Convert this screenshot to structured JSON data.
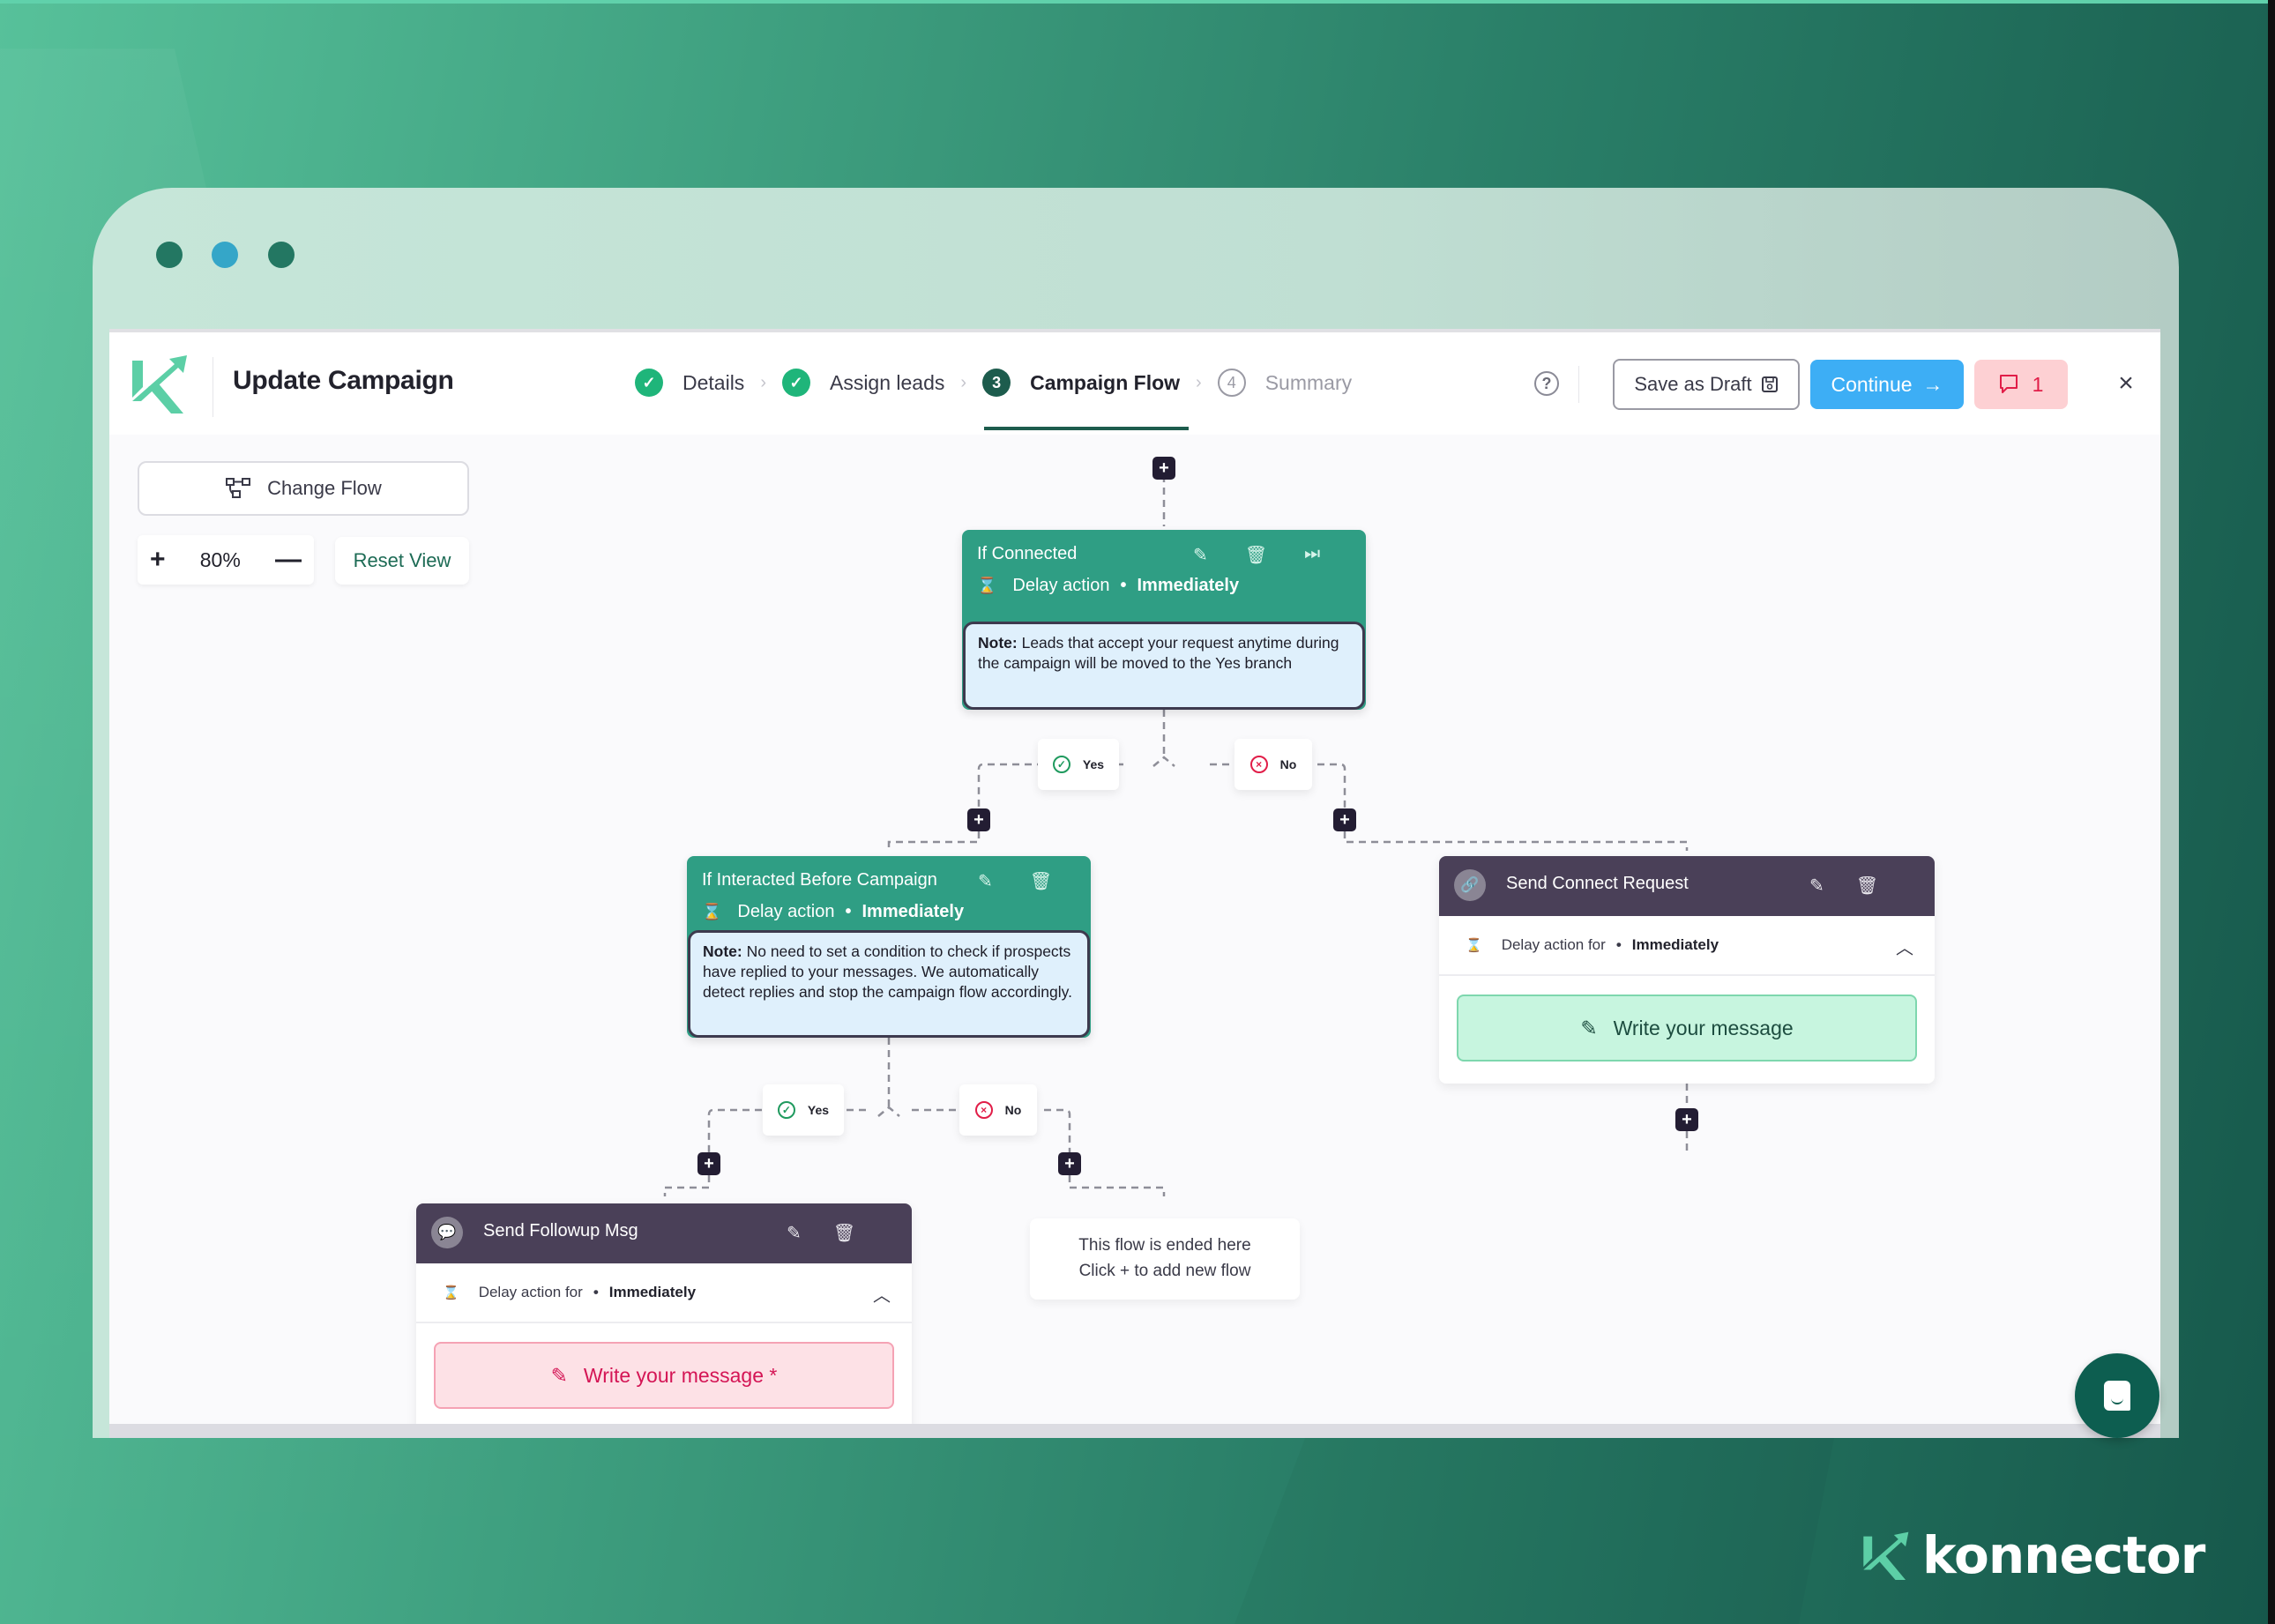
{
  "window": {
    "traffic_lights": [
      "#237762",
      "#35a6c8",
      "#237762"
    ]
  },
  "header": {
    "title": "Update Campaign",
    "steps": [
      {
        "number": "1",
        "label": "Details",
        "state": "done"
      },
      {
        "number": "2",
        "label": "Assign leads",
        "state": "done"
      },
      {
        "number": "3",
        "label": "Campaign Flow",
        "state": "active"
      },
      {
        "number": "4",
        "label": "Summary",
        "state": "todo"
      }
    ],
    "step_separator": ">",
    "help_icon": "?",
    "save_draft_label": "Save as Draft",
    "continue_label": "Continue",
    "comments_count": "1",
    "close_icon": "×"
  },
  "toolbar": {
    "change_flow_label": "Change Flow",
    "zoom_in": "+",
    "zoom_level": "80%",
    "zoom_out": "—",
    "reset_view_label": "Reset View"
  },
  "flow": {
    "add_symbol": "+",
    "nodes": {
      "if_connected": {
        "title": "If Connected",
        "delay_label": "Delay action",
        "delay_value": "Immediately",
        "note_prefix": "Note:",
        "note_text": " Leads that accept your request anytime during the campaign will be moved to the Yes branch"
      },
      "if_interacted": {
        "title": "If Interacted Before Campaign",
        "delay_label": "Delay action",
        "delay_value": "Immediately",
        "note_prefix": "Note:",
        "note_text": " No need to set a condition to check if prospects have replied to your messages. We automatically detect replies and stop the campaign flow accordingly."
      },
      "send_connect_request": {
        "title": "Send Connect Request",
        "delay_label": "Delay action for",
        "delay_value": "Immediately",
        "message_button": "Write your message"
      },
      "send_followup_msg": {
        "title": "Send Followup Msg",
        "delay_label": "Delay action for",
        "delay_value": "Immediately",
        "message_button": "Write your message *"
      }
    },
    "branch_labels": {
      "yes": "Yes",
      "no": "No"
    },
    "end_message": {
      "line1": "This flow is ended here",
      "line2": "Click + to add new flow"
    }
  },
  "colors": {
    "condition_node": "#2f9e84",
    "action_node_header": "#4a4058",
    "continue_button": "#3daef5",
    "comments_button_bg": "#fdd0d3",
    "error": "#e11d48",
    "success": "#1fb57a"
  },
  "brand": {
    "name": "konnector"
  }
}
